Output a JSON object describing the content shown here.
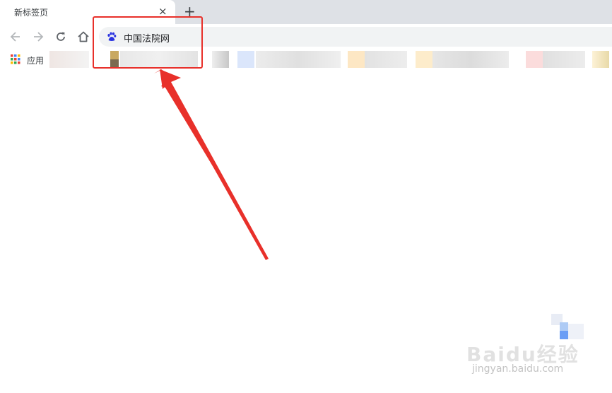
{
  "tab": {
    "title": "新标签页",
    "close_glyph": "×"
  },
  "new_tab_glyph": "+",
  "toolbar": {
    "back_icon": "back-arrow-icon",
    "forward_icon": "forward-arrow-icon",
    "reload_icon": "reload-icon",
    "home_icon": "home-icon"
  },
  "omnibox": {
    "icon": "baidu-paw-icon",
    "text": "中国法院网"
  },
  "bookmarks": {
    "apps_label": "应用",
    "apps_icon": "apps-grid-icon"
  },
  "colors": {
    "highlight": "#e8302a",
    "tabstrip": "#dee1e6",
    "omnibox": "#f1f3f4"
  },
  "watermark": {
    "brand": "Baidu经验",
    "url": "jingyan.baidu.com"
  }
}
